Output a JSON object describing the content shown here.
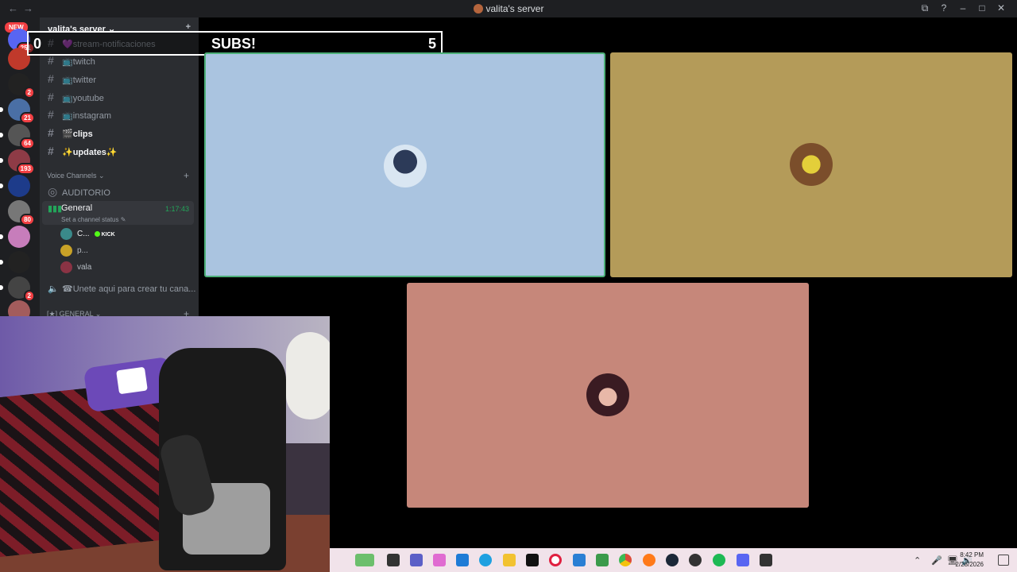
{
  "window": {
    "title": "valita's server",
    "nav_back": "←",
    "nav_forward": "→",
    "controls": [
      "⧉",
      "?",
      "–",
      "□",
      "✕"
    ]
  },
  "guild_rail": {
    "new_label": "NEW",
    "badges": [
      "251",
      "2",
      "21",
      "64",
      "193",
      "80",
      "2"
    ],
    "colors": [
      "#5865f2",
      "#c0392b",
      "#222222",
      "#4a6fa5",
      "#555555",
      "#8e3b46",
      "#1d3b8a",
      "#777777",
      "#c77dbb",
      "#222222",
      "#444444",
      "#a35c5c"
    ]
  },
  "server": {
    "name": "valita's server ⌄",
    "add_icon": "+"
  },
  "text_channels": [
    {
      "label": "💜stream-notificaciones",
      "bold": false
    },
    {
      "label": "📺twitch",
      "bold": false
    },
    {
      "label": "📺twitter",
      "bold": false
    },
    {
      "label": "📺youtube",
      "bold": false
    },
    {
      "label": "📺instagram",
      "bold": false
    },
    {
      "label": "🎬clips",
      "bold": true
    },
    {
      "label": "✨updates✨",
      "bold": true
    }
  ],
  "voice_category": {
    "label": "Voice Channels ⌄",
    "plus": "+"
  },
  "voice_channels": {
    "auditorio": "AUDITORIO",
    "general": {
      "name": "General",
      "time": "1:17:43",
      "status": "Set a channel status ✎"
    },
    "members": [
      {
        "name": "C...",
        "extra": "KICK",
        "color": "#3a8a8a"
      },
      {
        "name": "p...",
        "extra": "",
        "color": "#c9a227"
      },
      {
        "name": "vala",
        "extra": "",
        "color": "#8a3344"
      }
    ],
    "create": "☎Unete aqui para crear tu cana..."
  },
  "next_category": "[★] GENERAL ⌄",
  "subs_overlay": {
    "left": "0",
    "label": "SUBS!",
    "right": "5"
  },
  "tiles": [
    {
      "bg": "#aac4e0",
      "border": "#4caf78",
      "avatar": "#3a4b6a"
    },
    {
      "bg": "#b49b59",
      "border": "#b49b59",
      "avatar": "#d4b53a"
    },
    {
      "bg": "#c6877a",
      "border": "#c6877a",
      "avatar": "#5a2a35"
    }
  ],
  "taskbar": {
    "icons": [
      "#6cbf6c",
      "#333333",
      "#5b5fc7",
      "#e06bd1",
      "#1e7bd6",
      "#1fa0e0",
      "#f2c230",
      "#111111",
      "#e02040",
      "#2a7fd4",
      "#3b9a4b",
      "#dd4b39",
      "#ff7a1a",
      "#1b2838",
      "#333333",
      "#1db954",
      "#5865f2",
      "#333333"
    ],
    "tray": [
      "⌃",
      "🎤",
      "🖥",
      "🔊"
    ],
    "time": "8:42 PM",
    "date": "2/28/2026"
  }
}
